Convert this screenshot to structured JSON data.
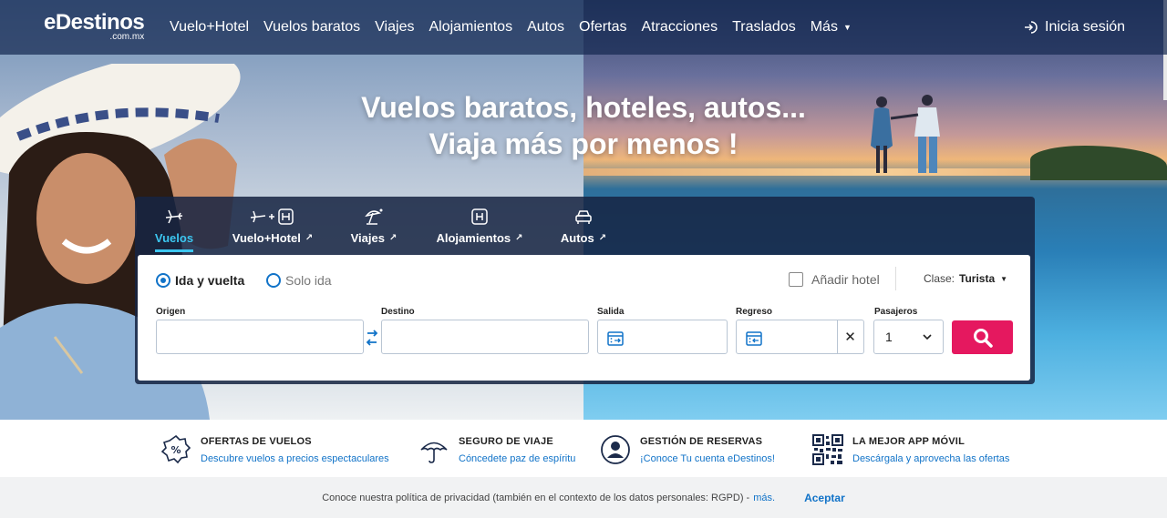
{
  "header": {
    "logo_main": "eDestinos",
    "logo_sub": ".com.mx",
    "nav": [
      {
        "label": "Vuelo+Hotel"
      },
      {
        "label": "Vuelos baratos"
      },
      {
        "label": "Viajes"
      },
      {
        "label": "Alojamientos"
      },
      {
        "label": "Autos"
      },
      {
        "label": "Ofertas"
      },
      {
        "label": "Atracciones"
      },
      {
        "label": "Traslados"
      },
      {
        "label": "Más"
      }
    ],
    "login_label": "Inicia sesión"
  },
  "hero": {
    "headline_line1": "Vuelos baratos, hoteles, autos...",
    "headline_line2": "Viaja más por menos !"
  },
  "search": {
    "tabs": [
      {
        "label": "Vuelos",
        "icon": "plane-icon",
        "active": true
      },
      {
        "label": "Vuelo+Hotel",
        "icon": "plane-hotel-icon",
        "external": true
      },
      {
        "label": "Viajes",
        "icon": "beach-umbrella-icon",
        "external": true
      },
      {
        "label": "Alojamientos",
        "icon": "hotel-icon",
        "external": true
      },
      {
        "label": "Autos",
        "icon": "car-icon",
        "external": true
      }
    ],
    "trip_type": {
      "round_trip": "Ida y vuelta",
      "one_way": "Solo ida",
      "selected": "round_trip"
    },
    "add_hotel_label": "Añadir hotel",
    "class_label": "Clase:",
    "class_value": "Turista",
    "fields": {
      "origin_label": "Origen",
      "origin_value": "",
      "destination_label": "Destino",
      "destination_value": "",
      "departure_label": "Salida",
      "return_label": "Regreso",
      "passengers_label": "Pasajeros",
      "passengers_value": "1"
    },
    "clear_symbol": "✕"
  },
  "features": [
    {
      "title": "OFERTAS DE VUELOS",
      "desc": "Descubre vuelos a precios espectaculares",
      "icon": "percent-badge-icon"
    },
    {
      "title": "SEGURO DE VIAJE",
      "desc": "Cóncedete paz de espíritu",
      "icon": "umbrella-icon"
    },
    {
      "title": "GESTIÓN DE RESERVAS",
      "desc": "¡Conoce Tu cuenta eDestinos!",
      "icon": "user-circle-icon"
    },
    {
      "title": "LA MEJOR APP MÓVIL",
      "desc": "Descárgala y aprovecha las ofertas",
      "icon": "qr-code-icon"
    }
  ],
  "cookie": {
    "text": "Conoce nuestra política de privacidad (también en el contexto de los datos personales: RGPD) -",
    "more_label": "más.",
    "accept_label": "Aceptar"
  },
  "colors": {
    "accent": "#3cc6f0",
    "link": "#1173c8",
    "search_button": "#e5185f",
    "header_bg": "#162a52"
  }
}
